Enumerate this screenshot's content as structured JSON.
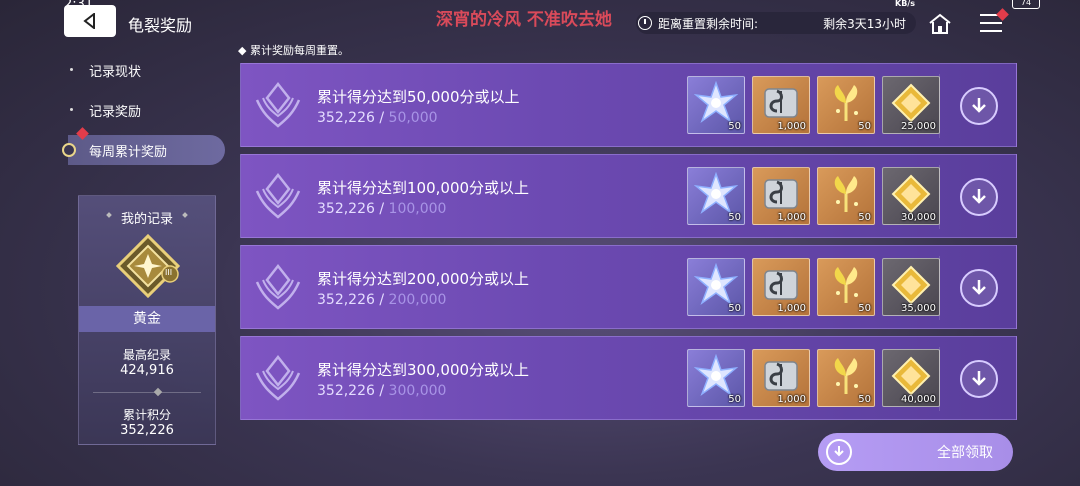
{
  "status_bar": {
    "time": "2:31",
    "net": "KB/s",
    "battery": "74"
  },
  "header": {
    "title": "龟裂奖励",
    "banner": "深宵的冷风 不准吹去她",
    "reset_label": "距离重置剩余时间:",
    "reset_value": "剩余3天13小时"
  },
  "sidebar": {
    "items": [
      {
        "label": "记录现状"
      },
      {
        "label": "记录奖励"
      },
      {
        "label": "每周累计奖励"
      }
    ],
    "active_index": 2
  },
  "record": {
    "title": "我的记录",
    "rank": "黄金",
    "rank_tier": "III",
    "best_label": "最高纪录",
    "best_value": "424,916",
    "total_label": "累计积分",
    "total_value": "352,226"
  },
  "notice": "累计奖励每周重置。",
  "rows": [
    {
      "requirement": "累计得分达到50,000分或以上",
      "current": "352,226",
      "sep": " / ",
      "goal": "50,000",
      "items": [
        {
          "icon": "crystal-star-icon",
          "qty": "50"
        },
        {
          "icon": "music-scroll-icon",
          "qty": "1,000"
        },
        {
          "icon": "gold-sprout-icon",
          "qty": "50"
        },
        {
          "icon": "gold-gem-icon",
          "qty": "25,000"
        }
      ]
    },
    {
      "requirement": "累计得分达到100,000分或以上",
      "current": "352,226",
      "sep": " / ",
      "goal": "100,000",
      "items": [
        {
          "icon": "crystal-star-icon",
          "qty": "50"
        },
        {
          "icon": "music-scroll-icon",
          "qty": "1,000"
        },
        {
          "icon": "gold-sprout-icon",
          "qty": "50"
        },
        {
          "icon": "gold-gem-icon",
          "qty": "30,000"
        }
      ]
    },
    {
      "requirement": "累计得分达到200,000分或以上",
      "current": "352,226",
      "sep": " / ",
      "goal": "200,000",
      "items": [
        {
          "icon": "crystal-star-icon",
          "qty": "50"
        },
        {
          "icon": "music-scroll-icon",
          "qty": "1,000"
        },
        {
          "icon": "gold-sprout-icon",
          "qty": "50"
        },
        {
          "icon": "gold-gem-icon",
          "qty": "35,000"
        }
      ]
    },
    {
      "requirement": "累计得分达到300,000分或以上",
      "current": "352,226",
      "sep": " / ",
      "goal": "300,000",
      "items": [
        {
          "icon": "crystal-star-icon",
          "qty": "50"
        },
        {
          "icon": "music-scroll-icon",
          "qty": "1,000"
        },
        {
          "icon": "gold-sprout-icon",
          "qty": "50"
        },
        {
          "icon": "gold-gem-icon",
          "qty": "40,000"
        }
      ]
    }
  ],
  "claim_all_label": "全部领取",
  "colors": {
    "accent": "#7e55c2",
    "badge": "#e23c4a",
    "banner": "#d94a5a"
  }
}
